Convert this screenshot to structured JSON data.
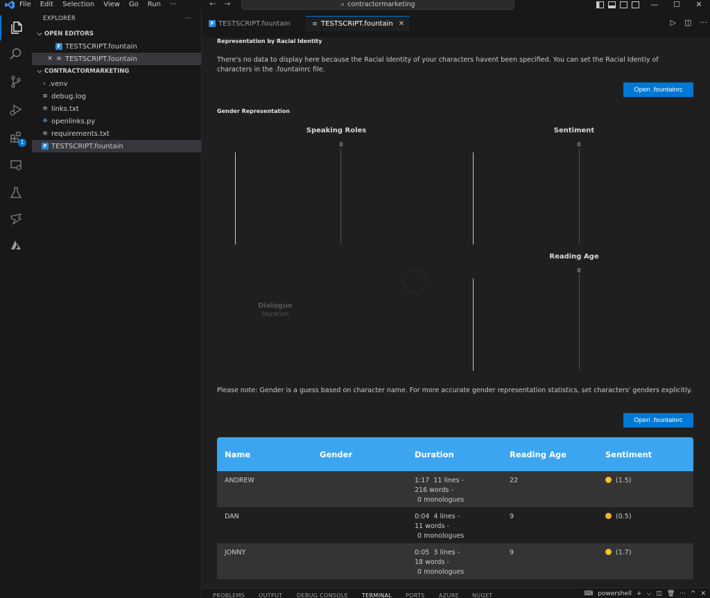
{
  "titlebar": {
    "menu": [
      "File",
      "Edit",
      "Selection",
      "View",
      "Go",
      "Run",
      "···"
    ],
    "command_center": "contractormarketing",
    "back": "←",
    "forward": "→",
    "minimize": "—",
    "maximize": "☐",
    "close": "✕"
  },
  "activity": {
    "extensions_badge": "1"
  },
  "sidebar": {
    "title": "EXPLORER",
    "more": "···",
    "open_editors_label": "OPEN EDITORS",
    "open_editors": [
      {
        "name": "TESTSCRIPT.fountain",
        "icon": "fountain-file-icon"
      },
      {
        "name": "TESTSCRIPT.fountain",
        "icon": "lines-file-icon"
      }
    ],
    "folder_label": "CONTRACTORMARKETING",
    "files": [
      {
        "name": ".venv",
        "type": "folder"
      },
      {
        "name": "debug.log",
        "type": "lines"
      },
      {
        "name": "links.txt",
        "type": "lines"
      },
      {
        "name": "openlinks.py",
        "type": "python"
      },
      {
        "name": "requirements.txt",
        "type": "lines"
      },
      {
        "name": "TESTSCRIPT.fountain",
        "type": "fountain"
      }
    ]
  },
  "tabs": [
    {
      "label": "TESTSCRIPT.fountain",
      "active": false
    },
    {
      "label": "TESTSCRIPT.fountain",
      "active": true
    }
  ],
  "editor": {
    "racial_title": "Representation by Racial Identity",
    "racial_text": "There's no data to display here because the Racial Identity of your characters havent been specified. You can set the Racial Identiy of characters in the .fountainrc file.",
    "open_button_1": "Open .fountainrc",
    "gender_title": "Gender Representation",
    "speaking_roles_title": "Speaking Roles",
    "speaking_roles_tick": "0",
    "sentiment_title": "Sentiment",
    "sentiment_tick": "0",
    "reading_age_title": "Reading Age",
    "reading_age_tick": "0",
    "dialogue_legend": "Dialogue",
    "duration_legend": "Duration",
    "note_text": "Please note: Gender is a guess based on character name. For more accurate gender representation statistics, set characters' genders explicitly.",
    "open_button_2": "Open .fountainrc"
  },
  "table": {
    "headers": [
      "Name",
      "Gender",
      "Duration",
      "Reading Age",
      "Sentiment"
    ],
    "rows": [
      {
        "name": "ANDREW",
        "gender": "",
        "duration_time": "1:17",
        "lines": "11 lines -",
        "words": "216 words -",
        "monologues": "0 monologues",
        "reading_age": "22",
        "sentiment": "(1.5)"
      },
      {
        "name": "DAN",
        "gender": "",
        "duration_time": "0:04",
        "lines": "4 lines -",
        "words": "11 words -",
        "monologues": "0 monologues",
        "reading_age": "9",
        "sentiment": "(0.5)"
      },
      {
        "name": "JONNY",
        "gender": "",
        "duration_time": "0:05",
        "lines": "3 lines -",
        "words": "18 words -",
        "monologues": "0 monologues",
        "reading_age": "9",
        "sentiment": "(1.7)"
      }
    ]
  },
  "panel": {
    "tabs": [
      "PROBLEMS",
      "OUTPUT",
      "DEBUG CONSOLE",
      "TERMINAL",
      "PORTS",
      "AZURE",
      "NUGET"
    ],
    "active": "TERMINAL",
    "shell": "powershell"
  },
  "colors": {
    "accent": "#0078d4",
    "table_header": "#3ba5f0"
  }
}
